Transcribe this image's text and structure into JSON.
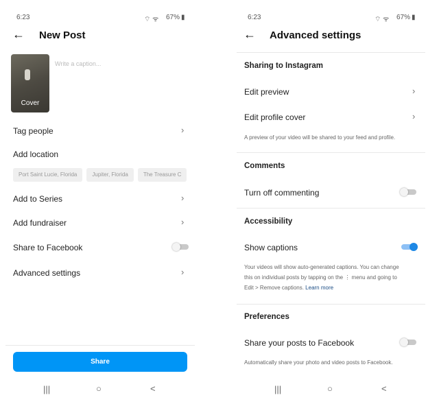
{
  "left": {
    "status": {
      "time": "6:23",
      "battery": "67%"
    },
    "header": {
      "title": "New Post"
    },
    "cover_label": "Cover",
    "caption_placeholder": "Write a caption...",
    "rows": {
      "tag_people": "Tag people",
      "add_location": "Add location",
      "add_to_series": "Add to Series",
      "add_fundraiser": "Add fundraiser",
      "share_facebook": "Share to Facebook",
      "advanced": "Advanced settings"
    },
    "location_chips": [
      "Port Saint Lucie, Florida",
      "Jupiter, Florida",
      "The Treasure C"
    ],
    "share_facebook_on": false,
    "share_button": "Share",
    "accent": "#0095f6"
  },
  "right": {
    "status": {
      "time": "6:23",
      "battery": "67%"
    },
    "header": {
      "title": "Advanced settings"
    },
    "sharing": {
      "title": "Sharing to Instagram",
      "edit_preview": "Edit preview",
      "edit_profile_cover": "Edit profile cover",
      "desc": "A preview of your video will be shared to your feed and profile."
    },
    "comments": {
      "title": "Comments",
      "turn_off": "Turn off commenting",
      "on": false
    },
    "accessibility": {
      "title": "Accessibility",
      "show_captions": "Show captions",
      "on": true,
      "desc1": "Your videos will show auto-generated captions. You can change",
      "desc2": "this on individual posts by tapping on the ⋮ menu and going to",
      "desc3": "Edit > Remove captions.",
      "learn_more": "Learn more"
    },
    "preferences": {
      "title": "Preferences",
      "share_fb": "Share your posts to Facebook",
      "on": false,
      "desc": "Automatically share your photo and video posts to Facebook."
    }
  },
  "nav": {
    "recents": "|||",
    "home": "○",
    "back": "<"
  }
}
